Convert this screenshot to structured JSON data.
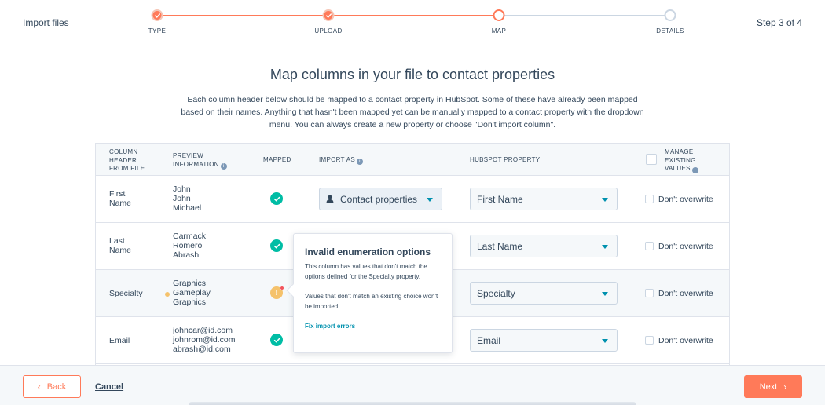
{
  "header": {
    "title": "Import files",
    "step_count": "Step 3 of 4",
    "steps": [
      {
        "label": "TYPE",
        "state": "done"
      },
      {
        "label": "UPLOAD",
        "state": "done"
      },
      {
        "label": "MAP",
        "state": "current"
      },
      {
        "label": "DETAILS",
        "state": "future"
      }
    ]
  },
  "page": {
    "title": "Map columns in your file to contact properties",
    "intro": "Each column header below should be mapped to a contact property in HubSpot. Some of these have already been mapped based on their names. Anything that hasn't been mapped yet can be manually mapped to a contact property with the dropdown menu. You can always create a new property or choose \"Don't import column\"."
  },
  "table": {
    "headers": {
      "column_header": "COLUMN HEADER FROM FILE",
      "preview": "PREVIEW INFORMATION",
      "mapped": "MAPPED",
      "import_as": "IMPORT AS",
      "hubspot_property": "HUBSPOT PROPERTY",
      "manage_existing": "MANAGE EXISTING VALUES"
    },
    "rows": [
      {
        "column": "First Name",
        "preview": [
          "John",
          "John",
          "Michael"
        ],
        "mapped": "ok",
        "import_as": "Contact properties",
        "property": "First Name",
        "overwrite_label": "Don't overwrite"
      },
      {
        "column": "Last Name",
        "preview": [
          "Carmack",
          "Romero",
          "Abrash"
        ],
        "mapped": "ok",
        "import_as": "",
        "property": "Last Name",
        "overwrite_label": "Don't overwrite"
      },
      {
        "column": "Specialty",
        "preview": [
          "Graphics",
          "Gameplay",
          "Graphics"
        ],
        "mapped": "warning",
        "warning_glyph": "!",
        "import_as": "",
        "property": "Specialty",
        "overwrite_label": "Don't overwrite"
      },
      {
        "column": "Email",
        "preview": [
          "johncar@id.com",
          "johnrom@id.com",
          "abrash@id.com"
        ],
        "mapped": "ok",
        "import_as": "",
        "property": "Email",
        "overwrite_label": "Don't overwrite"
      }
    ]
  },
  "popover": {
    "title": "Invalid enumeration options",
    "text1": "This column has values that don't match the options defined for the Specialty property.",
    "text2": "Values that don't match an existing choice won't be imported.",
    "link": "Fix import errors"
  },
  "footer": {
    "back_label": "Back",
    "cancel_label": "Cancel",
    "next_label": "Next"
  },
  "colors": {
    "accent": "#ff7a59",
    "success": "#00bda5",
    "warning": "#f5c26b",
    "link": "#0091ae",
    "text": "#33475b"
  }
}
